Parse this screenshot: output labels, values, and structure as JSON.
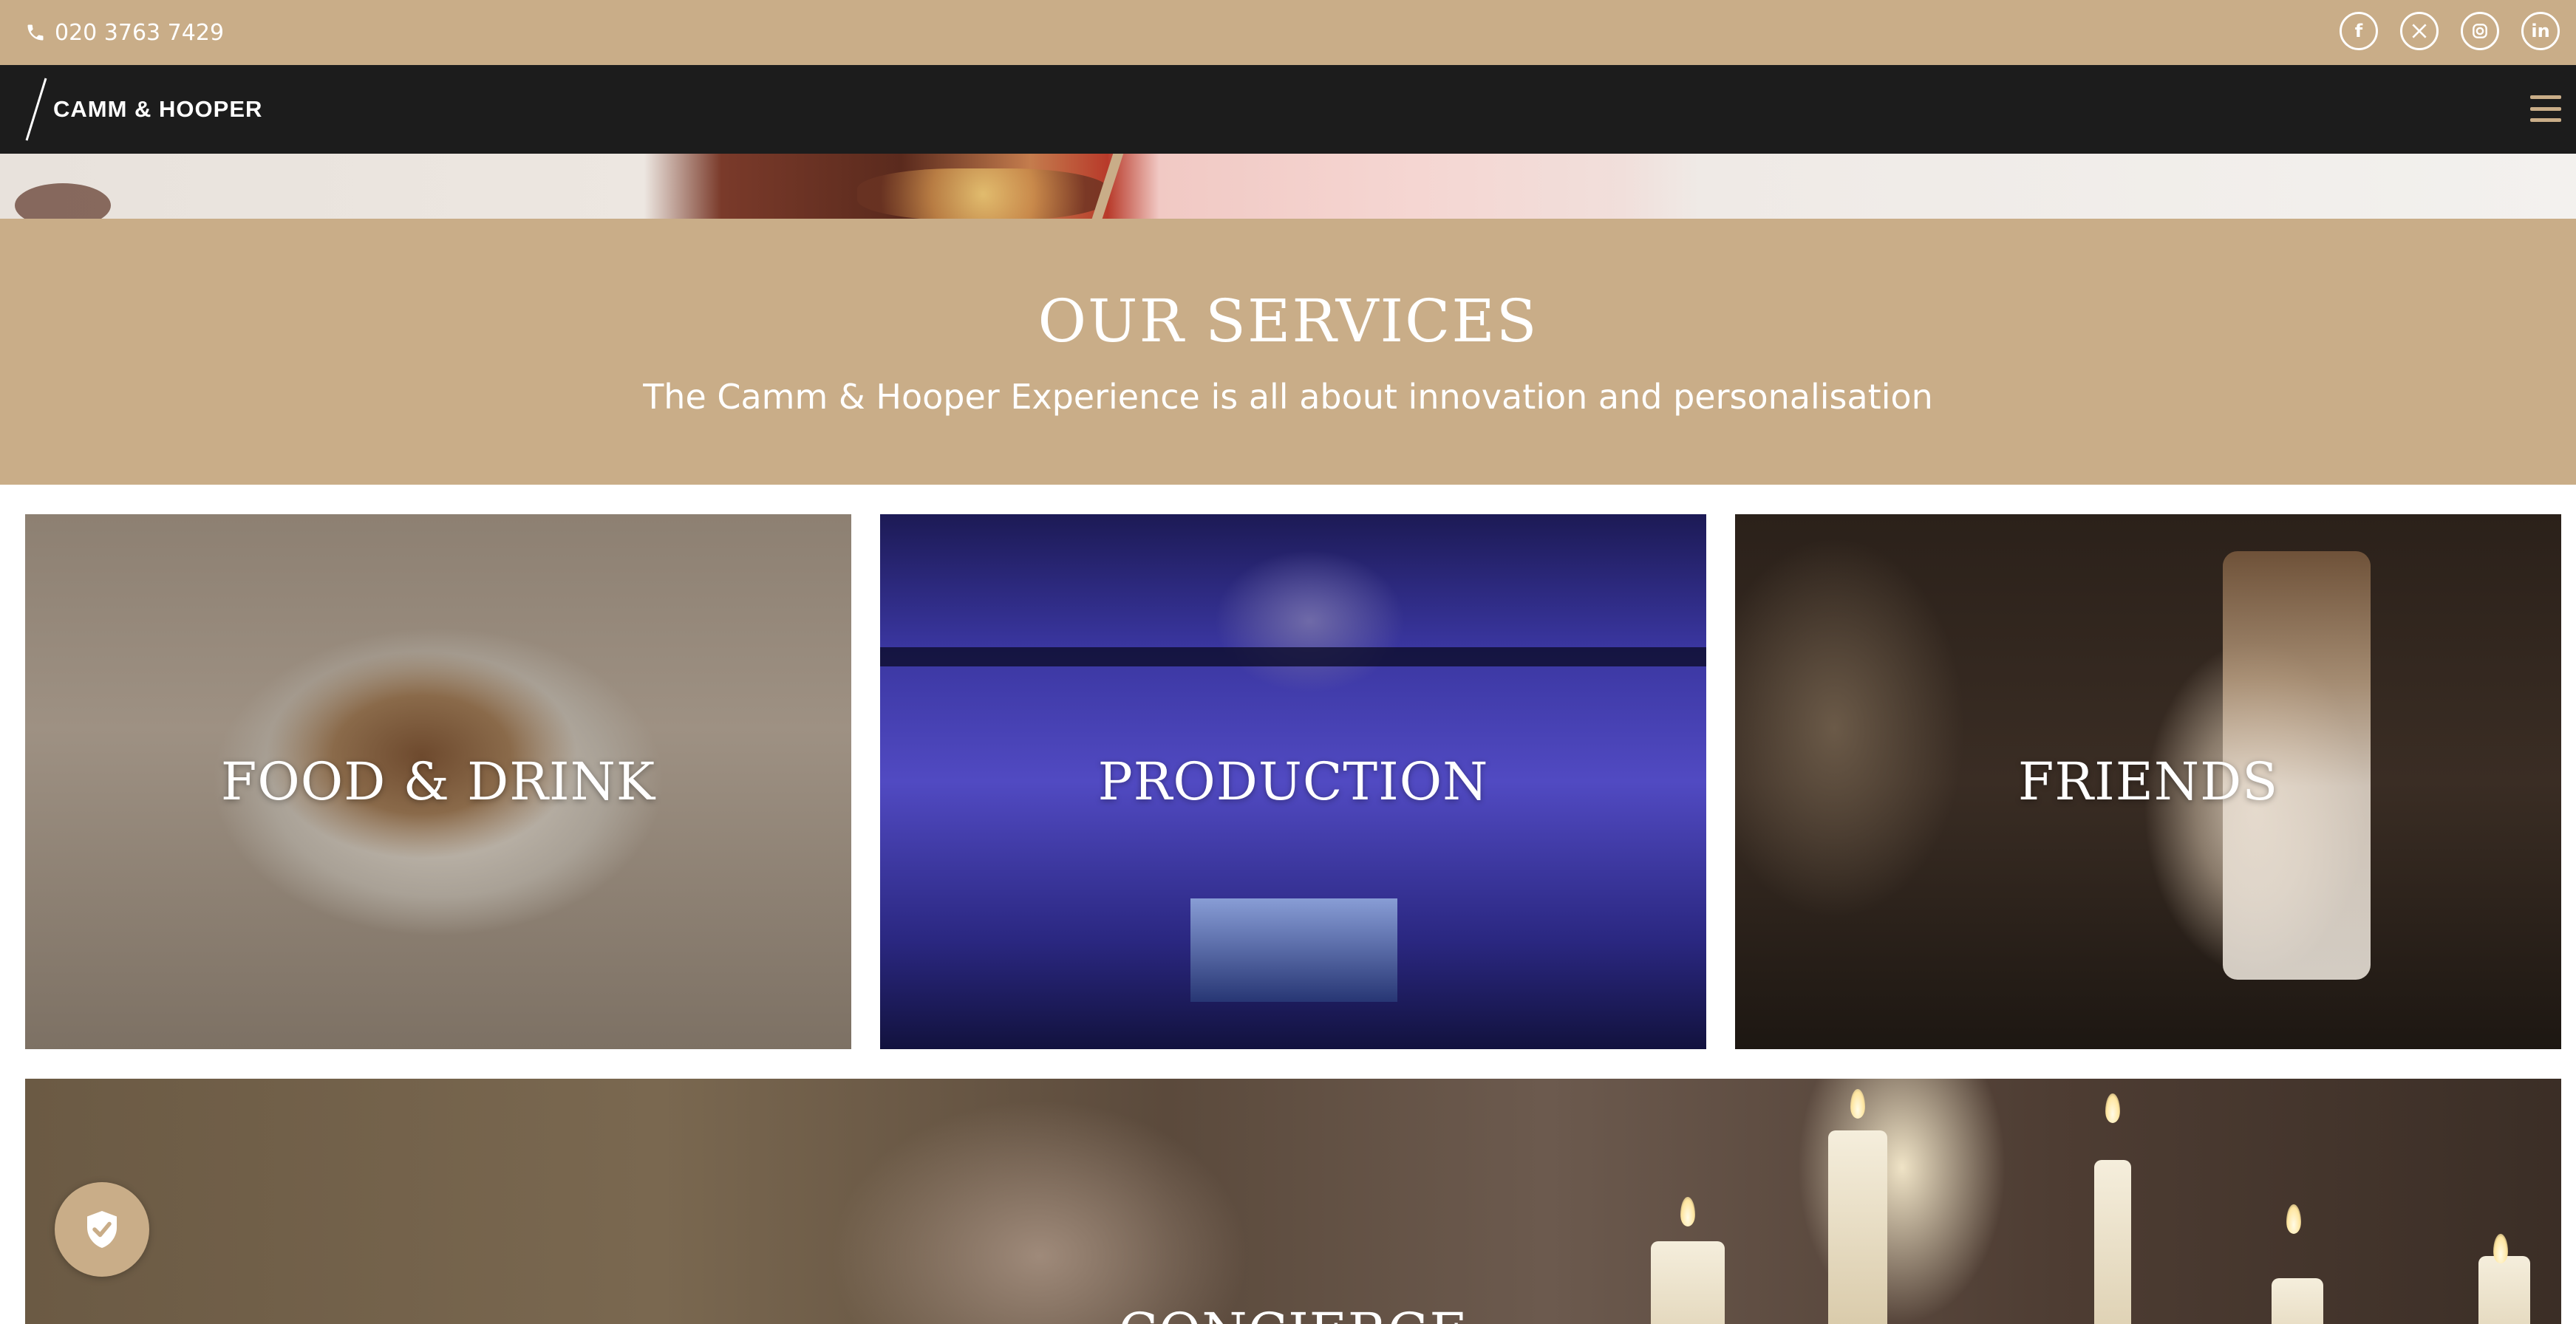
{
  "topbar": {
    "phone": "020 3763 7429",
    "socials": [
      {
        "icon": "facebook-icon",
        "glyph": "f"
      },
      {
        "icon": "x-twitter-icon",
        "glyph": "X"
      },
      {
        "icon": "instagram-icon",
        "glyph": ""
      },
      {
        "icon": "linkedin-icon",
        "glyph": "in"
      }
    ]
  },
  "nav": {
    "logo_text": "CAMM & HOOPER"
  },
  "services": {
    "title": "OUR SERVICES",
    "subtitle": "The Camm & Hooper Experience is all about innovation and personalisation"
  },
  "cards": [
    {
      "label": "FOOD & DRINK"
    },
    {
      "label": "PRODUCTION"
    },
    {
      "label": "FRIENDS"
    },
    {
      "label": "CONCIERGE"
    }
  ],
  "colors": {
    "accent": "#c9ad88",
    "nav_bg": "#1c1c1c",
    "text_light": "#ffffff"
  }
}
